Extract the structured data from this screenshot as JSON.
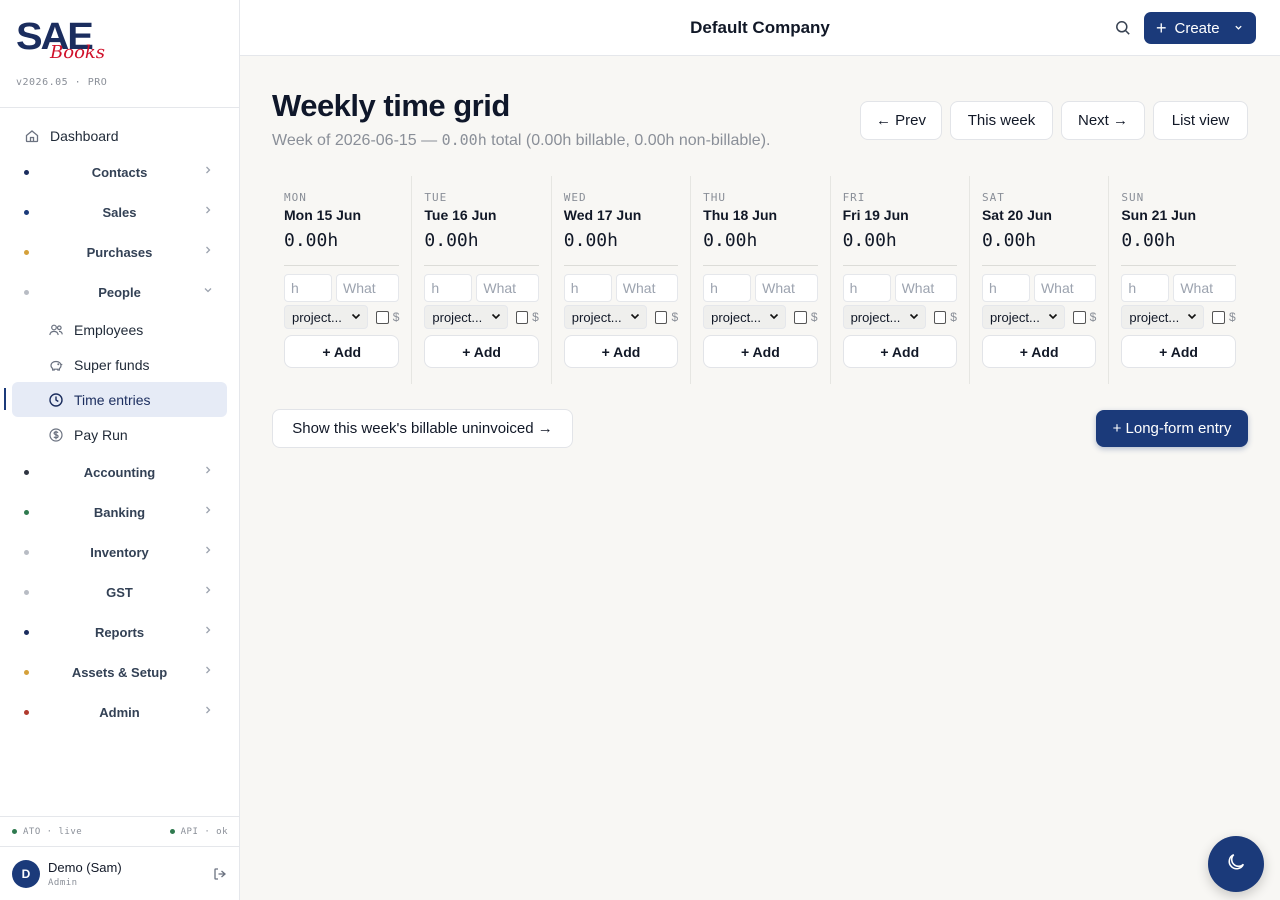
{
  "brand": {
    "logo_main": "SAE",
    "logo_sub": "Books",
    "version": "v2026.05 · PRO"
  },
  "sidebar": {
    "dashboard": "Dashboard",
    "groups": [
      {
        "label": "Contacts",
        "color": "#1b2d5e"
      },
      {
        "label": "Sales",
        "color": "#1b3a7a"
      },
      {
        "label": "Purchases",
        "color": "#d4a03a"
      },
      {
        "label": "People",
        "color": "#b8bcc4"
      }
    ],
    "people_items": [
      {
        "label": "Employees",
        "icon": "users-icon"
      },
      {
        "label": "Super funds",
        "icon": "piggy-bank-icon"
      },
      {
        "label": "Time entries",
        "icon": "clock-icon"
      },
      {
        "label": "Pay Run",
        "icon": "dollar-coin-icon"
      }
    ],
    "groups_after": [
      {
        "label": "Accounting",
        "color": "#2f3542"
      },
      {
        "label": "Banking",
        "color": "#2f7a4f"
      },
      {
        "label": "Inventory",
        "color": "#b8bcc4"
      },
      {
        "label": "GST",
        "color": "#b8bcc4"
      },
      {
        "label": "Reports",
        "color": "#1b2d5e"
      },
      {
        "label": "Assets & Setup",
        "color": "#d4a03a"
      },
      {
        "label": "Admin",
        "color": "#b03a2e"
      }
    ],
    "status_left": "ATO · live",
    "status_right": "API · ok",
    "user_initial": "D",
    "user_name": "Demo (Sam)",
    "user_role": "Admin"
  },
  "topbar": {
    "company": "Default Company",
    "create_label": "Create"
  },
  "page": {
    "title": "Weekly time grid",
    "subtitle_prefix": "Week of 2026-06-15 — ",
    "subtitle_total": "0.00h",
    "subtitle_suffix": " total (0.00h billable, 0.00h non-billable).",
    "prev": "← Prev",
    "this_week": "This week",
    "next": "Next →",
    "list_view": "List view",
    "uninvoiced": "Show this week's billable uninvoiced →",
    "long_form": "+ Long-form entry"
  },
  "days": [
    {
      "abbr": "MON",
      "date": "Mon 15 Jun",
      "total": "0.00h"
    },
    {
      "abbr": "TUE",
      "date": "Tue 16 Jun",
      "total": "0.00h"
    },
    {
      "abbr": "WED",
      "date": "Wed 17 Jun",
      "total": "0.00h"
    },
    {
      "abbr": "THU",
      "date": "Thu 18 Jun",
      "total": "0.00h"
    },
    {
      "abbr": "FRI",
      "date": "Fri 19 Jun",
      "total": "0.00h"
    },
    {
      "abbr": "SAT",
      "date": "Sat 20 Jun",
      "total": "0.00h"
    },
    {
      "abbr": "SUN",
      "date": "Sun 21 Jun",
      "total": "0.00h"
    }
  ],
  "day_form": {
    "hours_placeholder": "h",
    "what_placeholder": "What",
    "project_value": "project...",
    "billable_symbol": "$",
    "add_label": "+ Add"
  },
  "colors": {
    "accent": "#1b3a7a",
    "brand_red": "#d0102a"
  }
}
